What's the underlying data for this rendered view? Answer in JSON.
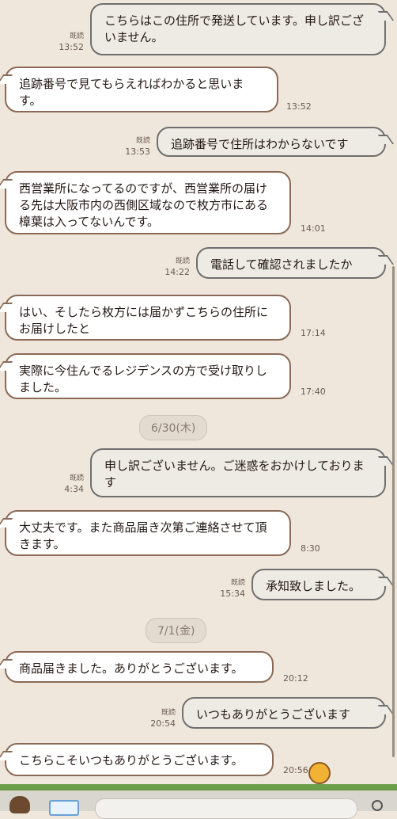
{
  "messages": [
    {
      "side": "out",
      "text": "こちらはこの住所で発送しています。申し訳ございません。",
      "read": "既読",
      "time": "13:52"
    },
    {
      "side": "in",
      "text": "追跡番号で見てもらえればわかると思います。",
      "time": "13:52"
    },
    {
      "side": "out",
      "text": "追跡番号で住所はわからないです",
      "read": "既読",
      "time": "13:53"
    },
    {
      "side": "in",
      "text": "西営業所になってるのですが、西営業所の届ける先は大阪市内の西側区域なので枚方市にある樟葉は入ってないんです。",
      "time": "14:01"
    },
    {
      "side": "out",
      "text": "電話して確認されましたか",
      "read": "既読",
      "time": "14:22"
    },
    {
      "side": "in",
      "text": "はい、そしたら枚方には届かずこちらの住所にお届けしたと",
      "time": "17:14"
    },
    {
      "side": "in",
      "text": "実際に今住んでるレジデンスの方で受け取りしました。",
      "time": "17:40"
    },
    {
      "side": "out",
      "text": "申し訳ございません。ご迷惑をおかけしております",
      "read": "既読",
      "time": "4:34"
    },
    {
      "side": "in",
      "text": "大丈夫です。また商品届き次第ご連絡させて頂きます。",
      "time": "8:30"
    },
    {
      "side": "out",
      "text": "承知致しました。",
      "read": "既読",
      "time": "15:34"
    },
    {
      "side": "in",
      "text": "商品届きました。ありがとうございます。",
      "time": "20:12"
    },
    {
      "side": "out",
      "text": "いつもありがとうございます",
      "read": "既読",
      "time": "20:54"
    },
    {
      "side": "in",
      "text": "こちらこそいつもありがとうございます。",
      "time": "20:56"
    }
  ],
  "dates": [
    "6/30(木)",
    "7/1(金)"
  ],
  "icons": {
    "bear": "bear-icon",
    "photo": "photo-icon",
    "search": "search-icon",
    "sticker": "sticker-icon"
  },
  "colors": {
    "background": "#efe7dc",
    "incoming_border": "#8a6a57",
    "outgoing_border": "#6f6f6f"
  }
}
